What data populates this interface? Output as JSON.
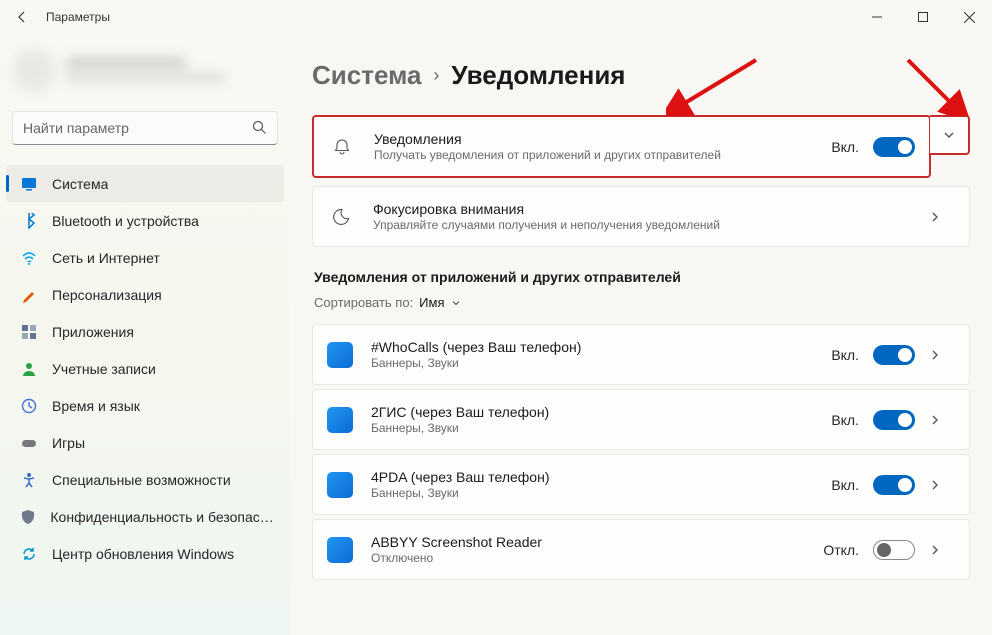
{
  "window": {
    "title": "Параметры"
  },
  "search": {
    "placeholder": "Найти параметр"
  },
  "nav": {
    "items": [
      {
        "label": "Система",
        "icon": "monitor",
        "color": "#0078d4",
        "active": true
      },
      {
        "label": "Bluetooth и устройства",
        "icon": "bluetooth",
        "color": "#0078d4"
      },
      {
        "label": "Сеть и Интернет",
        "icon": "wifi",
        "color": "#00a2ed"
      },
      {
        "label": "Персонализация",
        "icon": "brush",
        "color": "#e05a00"
      },
      {
        "label": "Приложения",
        "icon": "apps",
        "color": "#5f7590"
      },
      {
        "label": "Учетные записи",
        "icon": "user",
        "color": "#2aa147"
      },
      {
        "label": "Время и язык",
        "icon": "clock",
        "color": "#4a6fd4"
      },
      {
        "label": "Игры",
        "icon": "gamepad",
        "color": "#77787a"
      },
      {
        "label": "Специальные возможности",
        "icon": "accessibility",
        "color": "#3a6acb"
      },
      {
        "label": "Конфиденциальность и безопасность",
        "icon": "shield",
        "color": "#6f7b8a"
      },
      {
        "label": "Центр обновления Windows",
        "icon": "update",
        "color": "#0096d1"
      }
    ]
  },
  "breadcrumb": {
    "parent": "Система",
    "current": "Уведомления"
  },
  "notifications_card": {
    "title": "Уведомления",
    "subtitle": "Получать уведомления от приложений и других отправителей",
    "status": "Вкл.",
    "toggle_on": true
  },
  "focus_card": {
    "title": "Фокусировка внимания",
    "subtitle": "Управляйте случаями получения и неполучения уведомлений"
  },
  "apps_section": {
    "title": "Уведомления от приложений и других отправителей",
    "sort_label": "Сортировать по:",
    "sort_value": "Имя",
    "items": [
      {
        "name": "#WhoCalls (через Ваш телефон)",
        "sub": "Баннеры, Звуки",
        "status": "Вкл.",
        "on": true
      },
      {
        "name": "2ГИС (через Ваш телефон)",
        "sub": "Баннеры, Звуки",
        "status": "Вкл.",
        "on": true
      },
      {
        "name": "4PDA (через Ваш телефон)",
        "sub": "Баннеры, Звуки",
        "status": "Вкл.",
        "on": true
      },
      {
        "name": "ABBYY Screenshot Reader",
        "sub": "Отключено",
        "status": "Откл.",
        "on": false
      }
    ]
  }
}
